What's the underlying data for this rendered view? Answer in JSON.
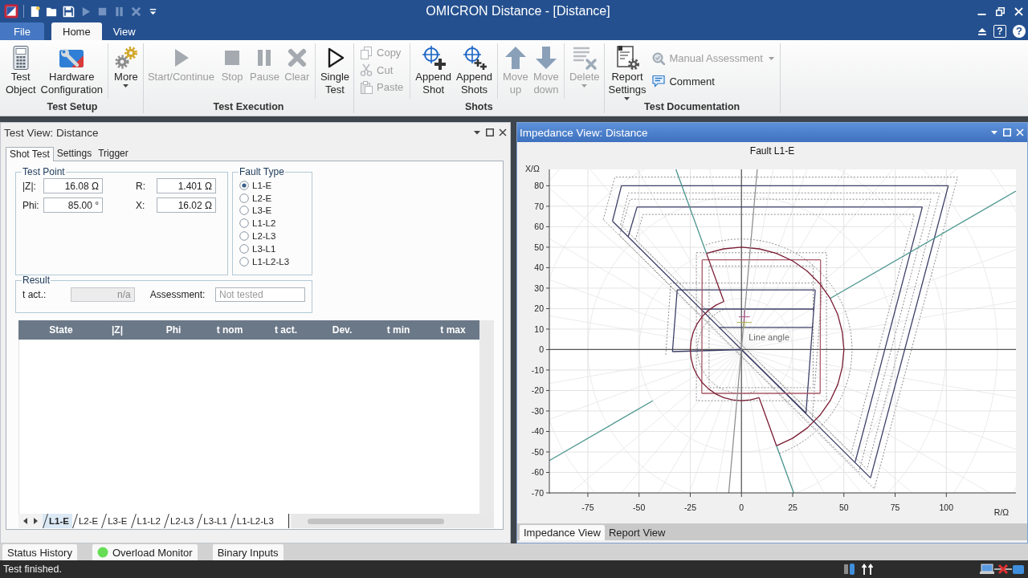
{
  "window": {
    "title": "OMICRON Distance - [Distance]"
  },
  "quick_access": [
    {
      "kind": "logo",
      "disabled": false
    },
    {
      "kind": "new",
      "disabled": false
    },
    {
      "kind": "open",
      "disabled": false
    },
    {
      "kind": "save",
      "disabled": false
    },
    {
      "kind": "play",
      "disabled": true
    },
    {
      "kind": "stop",
      "disabled": true
    },
    {
      "kind": "pause",
      "disabled": true
    },
    {
      "kind": "clear",
      "disabled": true
    },
    {
      "kind": "customize",
      "disabled": false
    }
  ],
  "ribbon": {
    "tabs": [
      {
        "label": "File",
        "kind": "backstage",
        "selected": false
      },
      {
        "label": "Home",
        "kind": "tab",
        "selected": true
      },
      {
        "label": "View",
        "kind": "tab",
        "selected": false
      }
    ],
    "help_buttons": [
      {
        "kind": "boxed",
        "label": "?"
      },
      {
        "kind": "round",
        "label": "?"
      }
    ],
    "groups": [
      {
        "label": "Test Setup",
        "sections": [
          {
            "kind": "large",
            "items": [
              {
                "label": "Test Object",
                "kind": "calculator",
                "disabled": false,
                "dropdown": false
              },
              {
                "label": "Hardware Configuration",
                "kind": "toolbox",
                "disabled": false,
                "dropdown": false
              }
            ]
          },
          {
            "kind": "large",
            "items": [
              {
                "label": "More",
                "kind": "gears",
                "disabled": false,
                "dropdown": true
              }
            ]
          }
        ]
      },
      {
        "label": "Test Execution",
        "sections": [
          {
            "kind": "large",
            "items": [
              {
                "label": "Start/Continue",
                "kind": "play",
                "disabled": true,
                "dropdown": false
              },
              {
                "label": "Stop",
                "kind": "stop",
                "disabled": true,
                "dropdown": false
              },
              {
                "label": "Pause",
                "kind": "pause",
                "disabled": true,
                "dropdown": false
              },
              {
                "label": "Clear",
                "kind": "clear",
                "disabled": true,
                "dropdown": false
              }
            ]
          },
          {
            "kind": "large",
            "items": [
              {
                "label": "Single Test",
                "kind": "play_outline",
                "disabled": false,
                "dropdown": false
              }
            ]
          }
        ]
      },
      {
        "label": "Shots",
        "sections": [
          {
            "kind": "small",
            "items": [
              {
                "label": "Copy",
                "kind": "copy",
                "disabled": true,
                "dropdown": false
              },
              {
                "label": "Cut",
                "kind": "cut",
                "disabled": true,
                "dropdown": false
              },
              {
                "label": "Paste",
                "kind": "paste",
                "disabled": true,
                "dropdown": false
              }
            ]
          },
          {
            "kind": "large",
            "items": [
              {
                "label": "Append Shot",
                "kind": "append_one",
                "disabled": false,
                "dropdown": false
              },
              {
                "label": "Append Shots",
                "kind": "append_many",
                "disabled": false,
                "dropdown": false
              }
            ]
          },
          {
            "kind": "large",
            "items": [
              {
                "label": "Move up",
                "kind": "arrow_up",
                "disabled": true,
                "dropdown": false
              },
              {
                "label": "Move down",
                "kind": "arrow_down",
                "disabled": true,
                "dropdown": false
              }
            ]
          },
          {
            "kind": "large",
            "items": [
              {
                "label": "Delete",
                "kind": "delete_list",
                "disabled": true,
                "dropdown": true
              }
            ]
          }
        ]
      },
      {
        "label": "Test Documentation",
        "sections": [
          {
            "kind": "large",
            "items": [
              {
                "label": "Report Settings",
                "kind": "report",
                "disabled": false,
                "dropdown": true
              }
            ]
          },
          {
            "kind": "small",
            "items": [
              {
                "label": "Manual Assessment",
                "kind": "assessment",
                "disabled": true,
                "dropdown": true
              },
              {
                "label": "Comment",
                "kind": "comment",
                "disabled": false,
                "dropdown": false
              }
            ]
          }
        ]
      }
    ]
  },
  "test_view": {
    "title": "Test View: Distance",
    "tabs": [
      {
        "label": "Shot Test",
        "selected": true
      },
      {
        "label": "Settings",
        "selected": false
      },
      {
        "label": "Trigger",
        "selected": false
      }
    ],
    "test_point": {
      "title": "Test Point",
      "fields": [
        {
          "label": "|Z|:",
          "value": "16.08 Ω"
        },
        {
          "label": "R:",
          "value": "1.401 Ω"
        },
        {
          "label": "Phi:",
          "value": "85.00 °"
        },
        {
          "label": "X:",
          "value": "16.02 Ω"
        }
      ]
    },
    "fault_type": {
      "title": "Fault Type",
      "options": [
        {
          "label": "L1-E",
          "selected": true
        },
        {
          "label": "L2-E",
          "selected": false
        },
        {
          "label": "L3-E",
          "selected": false
        },
        {
          "label": "L1-L2",
          "selected": false
        },
        {
          "label": "L2-L3",
          "selected": false
        },
        {
          "label": "L3-L1",
          "selected": false
        },
        {
          "label": "L1-L2-L3",
          "selected": false
        }
      ]
    },
    "result": {
      "title": "Result",
      "t_act": {
        "label": "t act.:",
        "value": "n/a",
        "disabled": true
      },
      "assessment": {
        "label": "Assessment:",
        "placeholder": "Not tested"
      }
    },
    "table": {
      "columns": [
        "State",
        "|Z|",
        "Phi",
        "t nom",
        "t act.",
        "Dev.",
        "t min",
        "t max"
      ]
    },
    "sheet_tabs": [
      {
        "label": "L1-E",
        "selected": true
      },
      {
        "label": "L2-E",
        "selected": false
      },
      {
        "label": "L3-E",
        "selected": false
      },
      {
        "label": "L1-L2",
        "selected": false
      },
      {
        "label": "L2-L3",
        "selected": false
      },
      {
        "label": "L3-L1",
        "selected": false
      },
      {
        "label": "L1-L2-L3",
        "selected": false
      }
    ]
  },
  "impedance_view": {
    "title": "Impedance View: Distance",
    "chart_data": {
      "type": "line",
      "title": "Fault L1-E",
      "xlabel": "R/Ω",
      "ylabel": "X/Ω",
      "xlim": [
        -93.8,
        134
      ],
      "ylim": [
        -70,
        88
      ],
      "xticks": [
        -75,
        -50,
        -25,
        0,
        25,
        50,
        75,
        100
      ],
      "yticks": [
        -70,
        -60,
        -50,
        -40,
        -30,
        -20,
        -10,
        0,
        10,
        20,
        30,
        40,
        50,
        60,
        70,
        80
      ],
      "grid": true,
      "series": [
        {
          "color": "#3d3f66",
          "x": [
            -63,
            -58.6,
            101
          ],
          "values": [
            62.7,
            80,
            80
          ]
        },
        {
          "color": "#3d3f66",
          "x": [
            63,
            101
          ],
          "values": [
            -62.7,
            80
          ]
        },
        {
          "color": "#3d3f66",
          "x": [
            -63,
            63
          ],
          "values": [
            62.7,
            -62.7
          ]
        },
        {
          "color": "#3d3f66",
          "x": [
            -55.3,
            -51,
            88.3
          ],
          "values": [
            55.2,
            69.6,
            69.6
          ]
        },
        {
          "color": "#3d3f66",
          "x": [
            55.5,
            88.3
          ],
          "values": [
            -55,
            69.6
          ]
        },
        {
          "color": "#3d3f66",
          "x": [
            -33.7,
            0
          ],
          "values": [
            -1,
            0
          ]
        },
        {
          "color": "#3d3f66",
          "x": [
            -33.7,
            -31.4,
            36
          ],
          "values": [
            -1,
            29.1,
            29.1
          ]
        },
        {
          "color": "#3d3f66",
          "x": [
            31.5,
            36
          ],
          "values": [
            -31,
            29.1
          ]
        },
        {
          "color": "#3d3f66",
          "x": [
            0,
            31.5
          ],
          "values": [
            0,
            -31
          ]
        },
        {
          "color": "#3d3f66",
          "x": [
            -19.8,
            35.2
          ],
          "values": [
            19.8,
            19.8
          ]
        },
        {
          "color": "#3d3f66",
          "x": [
            -10.8,
            34.7
          ],
          "values": [
            10.8,
            10.8
          ]
        },
        {
          "color": "#a65a68",
          "x": [
            -19.2,
            38.6
          ],
          "values": [
            43.8,
            43.8
          ]
        },
        {
          "color": "#a65a68",
          "x": [
            -19.4,
            38.4
          ],
          "values": [
            -21.4,
            -21.4
          ]
        },
        {
          "color": "#a65a68",
          "x": [
            -19.4,
            -19.2
          ],
          "values": [
            -21.4,
            43.8
          ]
        },
        {
          "color": "#a65a68",
          "x": [
            38.4,
            38.6
          ],
          "values": [
            -21.4,
            43.8
          ]
        },
        {
          "color": "#7b1d35",
          "x": [
            17.1,
            25,
            32.1,
            38.3,
            43.3,
            47,
            49.2,
            50,
            49.2,
            47,
            43.3,
            38.3,
            32.1,
            25,
            17.1,
            8.7,
            0,
            -8.7,
            -17.1
          ],
          "values": [
            -47,
            -43.3,
            -38.3,
            -32.1,
            -25,
            -17.1,
            -8.7,
            0,
            8.7,
            17.1,
            25,
            32.1,
            38.3,
            43.3,
            47,
            49.2,
            50,
            49.2,
            47
          ]
        },
        {
          "color": "#7b1d35",
          "x": [
            -17.1,
            -8.6
          ],
          "values": [
            47,
            23.5
          ]
        },
        {
          "color": "#7b1d35",
          "x": [
            -8.6,
            -12.5,
            -16.1,
            -19.2,
            -21.7,
            -23.5,
            -24.6,
            -25,
            -24.6,
            -23.5,
            -21.7,
            -19.2,
            -16.1,
            -12.5,
            -8.6,
            -4.3,
            0,
            4.3,
            8.6
          ],
          "values": [
            23.5,
            21.7,
            19.2,
            16.1,
            12.5,
            8.6,
            4.3,
            0,
            -4.3,
            -8.6,
            -12.5,
            -16.1,
            -19.2,
            -21.7,
            -23.5,
            -24.6,
            -25,
            -24.6,
            -23.5
          ]
        },
        {
          "color": "#7b1d35",
          "x": [
            8.6,
            17.1
          ],
          "values": [
            -23.5,
            -47
          ]
        },
        {
          "color": "#4b9690",
          "x": [
            -32,
            -17.1
          ],
          "values": [
            88,
            47
          ]
        },
        {
          "color": "#4b9690",
          "x": [
            17.1,
            25.5
          ],
          "values": [
            -47,
            -70
          ]
        },
        {
          "color": "#4b9690",
          "x": [
            43.3,
            134
          ],
          "values": [
            25,
            77.4
          ]
        },
        {
          "color": "#4b9690",
          "x": [
            -93.8,
            -43.3
          ],
          "values": [
            -54.2,
            -25
          ]
        },
        {
          "color": "#909090",
          "x": [
            -6.2,
            7.7
          ],
          "values": [
            -70,
            88
          ]
        }
      ],
      "annotations": [
        "Line angle"
      ]
    },
    "tabs": [
      {
        "label": "Impedance View",
        "selected": true
      },
      {
        "label": "Report View",
        "selected": false
      }
    ]
  },
  "dock_tabs": [
    {
      "label": "Status History"
    },
    {
      "label": "Overload Monitor",
      "color": "#66dd55"
    },
    {
      "label": "Binary Inputs"
    }
  ],
  "status_bar": {
    "message": "Test finished."
  }
}
